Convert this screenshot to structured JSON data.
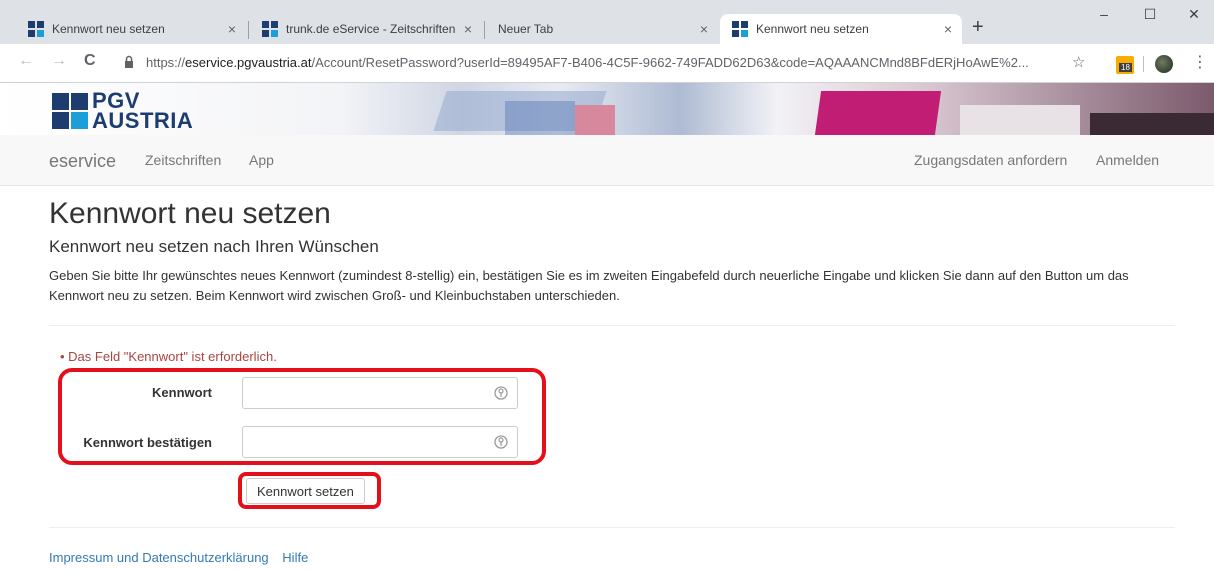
{
  "browser": {
    "tabs": [
      {
        "title": "Kennwort neu setzen",
        "favicon": "pgv-grid-icon",
        "close": "×"
      },
      {
        "title": "trunk.de eService - Zeitschriften",
        "favicon": "pgv-grid-icon",
        "close": "×"
      },
      {
        "title": "Neuer Tab",
        "favicon": "",
        "close": "×"
      },
      {
        "title": "Kennwort neu setzen",
        "favicon": "pgv-grid-icon",
        "close": "×",
        "active": true
      }
    ],
    "new_tab": "+",
    "window_controls": {
      "minimize": "–",
      "maximize": "☐",
      "close": "✕"
    },
    "nav": {
      "back": "←",
      "forward": "→",
      "reload": "C"
    },
    "url": {
      "scheme": "https://",
      "host": "eservice.pgvaustria.at",
      "path": "/Account/ResetPassword?userId=89495AF7-B406-4C5F-9662-749FADD62D63&code=AQAAANCMnd8BFdERjHoAwE%2..."
    },
    "bookmark_star": "☆",
    "extension_badge": "18",
    "menu": "⋮"
  },
  "brand": {
    "logo_line1": "PGV",
    "logo_line2": "AUSTRIA",
    "logo_colors": {
      "dark": "#1d3c6f",
      "light": "#1a9fd8"
    }
  },
  "navbar": {
    "brand": "eservice",
    "links": [
      "Zeitschriften",
      "App"
    ],
    "right_links": [
      "Zugangsdaten anfordern",
      "Anmelden"
    ]
  },
  "page": {
    "title": "Kennwort neu setzen",
    "subtitle": "Kennwort neu setzen nach Ihren Wünschen",
    "intro": "Geben Sie bitte Ihr gewünschtes neues Kennwort (zumindest 8-stellig) ein, bestätigen Sie es im zweiten Eingabefeld durch neuerliche Eingabe und klicken Sie dann auf den Button um das Kennwort neu zu setzen. Beim Kennwort wird zwischen Groß- und Kleinbuchstaben unterschieden.",
    "error": "• Das Feld \"Kennwort\" ist erforderlich.",
    "form": {
      "password_label": "Kennwort",
      "password_value": "",
      "confirm_label": "Kennwort bestätigen",
      "confirm_value": "",
      "submit_label": "Kennwort setzen"
    },
    "annotation_color": "#e3101c",
    "footer": [
      "Impressum und Datenschutzerklärung",
      "Hilfe"
    ]
  }
}
